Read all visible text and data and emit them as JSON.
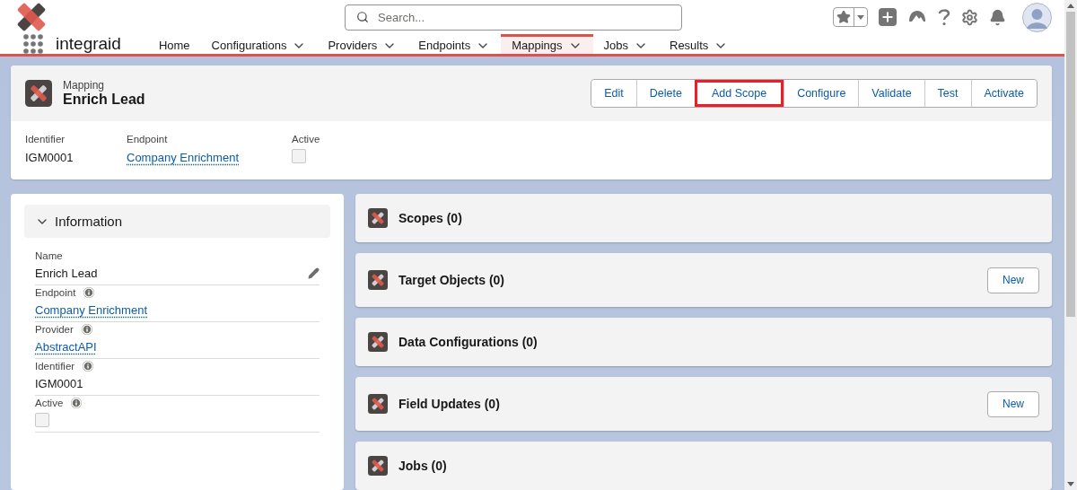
{
  "header": {
    "search": {
      "placeholder": "Search..."
    }
  },
  "nav": {
    "app_name": "integraid",
    "tabs": [
      {
        "label": "Home",
        "selected": false,
        "has_menu": false
      },
      {
        "label": "Configurations",
        "selected": false,
        "has_menu": true
      },
      {
        "label": "Providers",
        "selected": false,
        "has_menu": true
      },
      {
        "label": "Endpoints",
        "selected": false,
        "has_menu": true
      },
      {
        "label": "Mappings",
        "selected": true,
        "has_menu": true
      },
      {
        "label": "Jobs",
        "selected": false,
        "has_menu": true
      },
      {
        "label": "Results",
        "selected": false,
        "has_menu": true
      }
    ]
  },
  "record": {
    "object_type": "Mapping",
    "title": "Enrich Lead",
    "actions": [
      {
        "label": "Edit",
        "highlighted": false
      },
      {
        "label": "Delete",
        "highlighted": false
      },
      {
        "label": "Add Scope",
        "highlighted": true
      },
      {
        "label": "Configure",
        "highlighted": false
      },
      {
        "label": "Validate",
        "highlighted": false
      },
      {
        "label": "Test",
        "highlighted": false
      },
      {
        "label": "Activate",
        "highlighted": false
      }
    ],
    "highlights": [
      {
        "label": "Identifier",
        "kind": "text",
        "value": "IGM0001"
      },
      {
        "label": "Endpoint",
        "kind": "link",
        "value": "Company Enrichment"
      },
      {
        "label": "Active",
        "kind": "checkbox",
        "checked": false
      }
    ]
  },
  "information": {
    "title": "Information",
    "expanded": true,
    "fields": [
      {
        "label": "Name",
        "kind": "text",
        "value": "Enrich Lead",
        "info": false,
        "editable": true
      },
      {
        "label": "Endpoint",
        "kind": "link",
        "value": "Company Enrichment",
        "info": true,
        "editable": false
      },
      {
        "label": "Provider",
        "kind": "link",
        "value": "AbstractAPI",
        "info": true,
        "editable": false
      },
      {
        "label": "Identifier",
        "kind": "text",
        "value": "IGM0001",
        "info": true,
        "editable": false
      },
      {
        "label": "Active",
        "kind": "checkbox",
        "checked": false,
        "info": true,
        "editable": false
      }
    ]
  },
  "related_lists": [
    {
      "title": "Scopes (0)"
    },
    {
      "title": "Target Objects (0)",
      "new_button": "New"
    },
    {
      "title": "Data Configurations (0)"
    },
    {
      "title": "Field Updates (0)",
      "new_button": "New"
    },
    {
      "title": "Jobs (0)"
    }
  ]
}
